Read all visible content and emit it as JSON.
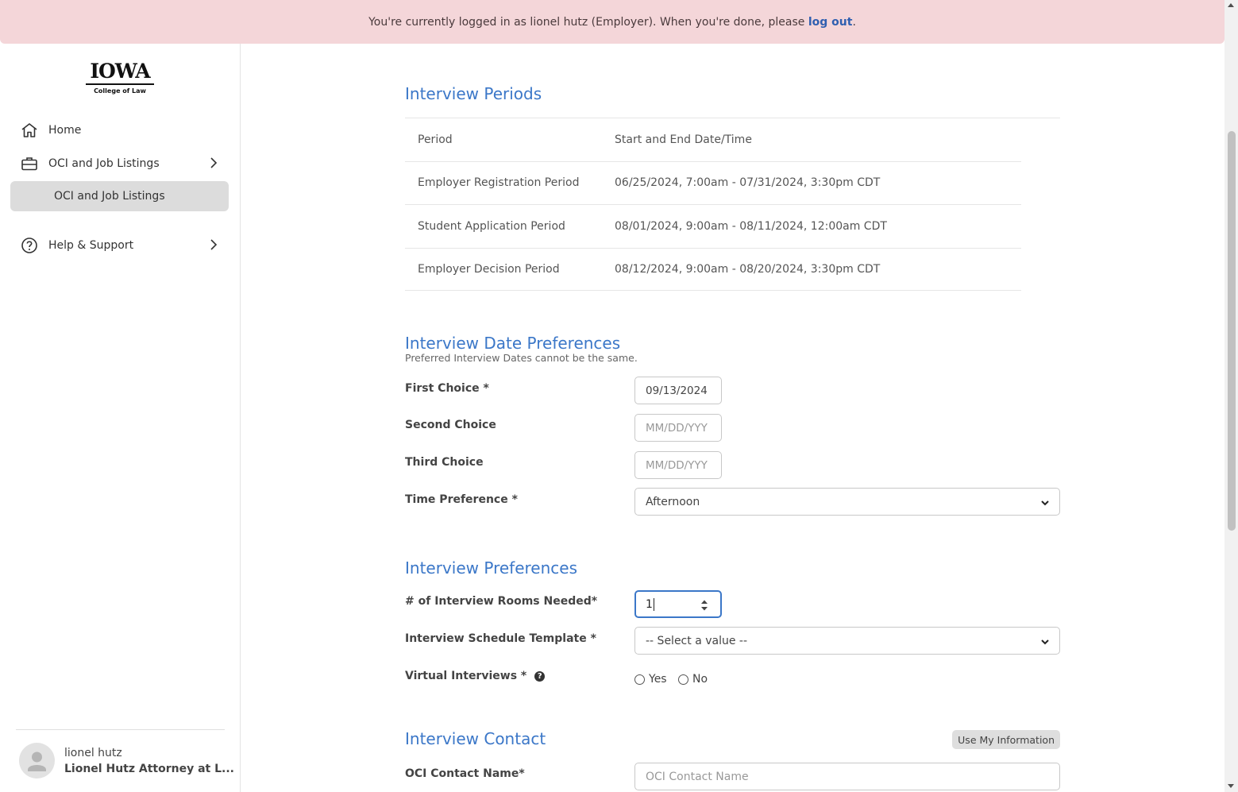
{
  "banner": {
    "text": "You're currently logged in as lionel hutz (Employer). When you're done, please ",
    "link": "log out",
    "suffix": "."
  },
  "logo": {
    "word": "IOWA",
    "sub": "College of Law"
  },
  "sidebar": {
    "items": [
      {
        "label": "Home",
        "icon": "home-icon"
      },
      {
        "label": "OCI and Job Listings",
        "icon": "briefcase-icon"
      },
      {
        "label": "OCI and Job Listings"
      },
      {
        "label": "Help & Support",
        "icon": "question-circle-icon"
      }
    ]
  },
  "user": {
    "name": "lionel hutz",
    "org": "Lionel Hutz Attorney at L..."
  },
  "interview_periods": {
    "title": "Interview Periods",
    "headers": [
      "Period",
      "Start and End Date/Time"
    ],
    "rows": [
      [
        "Employer Registration Period",
        "06/25/2024, 7:00am - 07/31/2024, 3:30pm CDT"
      ],
      [
        "Student Application Period",
        "08/01/2024, 9:00am - 08/11/2024, 12:00am CDT"
      ],
      [
        "Employer Decision Period",
        "08/12/2024, 9:00am - 08/20/2024, 3:30pm CDT"
      ]
    ]
  },
  "date_prefs": {
    "title": "Interview Date Preferences",
    "note": "Preferred Interview Dates cannot be the same.",
    "first_label": "First Choice *",
    "first_value": "09/13/2024",
    "second_label": "Second Choice",
    "second_placeholder": "MM/DD/YYY",
    "third_label": "Third Choice",
    "third_placeholder": "MM/DD/YYY",
    "time_label": "Time Preference *",
    "time_value": "Afternoon"
  },
  "interview_prefs": {
    "title": "Interview Preferences",
    "rooms_label": "# of Interview Rooms Needed*",
    "rooms_value": "1",
    "template_label": "Interview Schedule Template *",
    "template_value": "-- Select a value --",
    "virtual_label": "Virtual Interviews *",
    "yes": "Yes",
    "no": "No"
  },
  "contact": {
    "title": "Interview Contact",
    "use_button": "Use My Information",
    "name_label": "OCI Contact Name*",
    "name_placeholder": "OCI Contact Name"
  },
  "colors": {
    "accent": "#3b77c8",
    "banner_bg": "#f4d6d9",
    "link": "#2f5fb0"
  }
}
